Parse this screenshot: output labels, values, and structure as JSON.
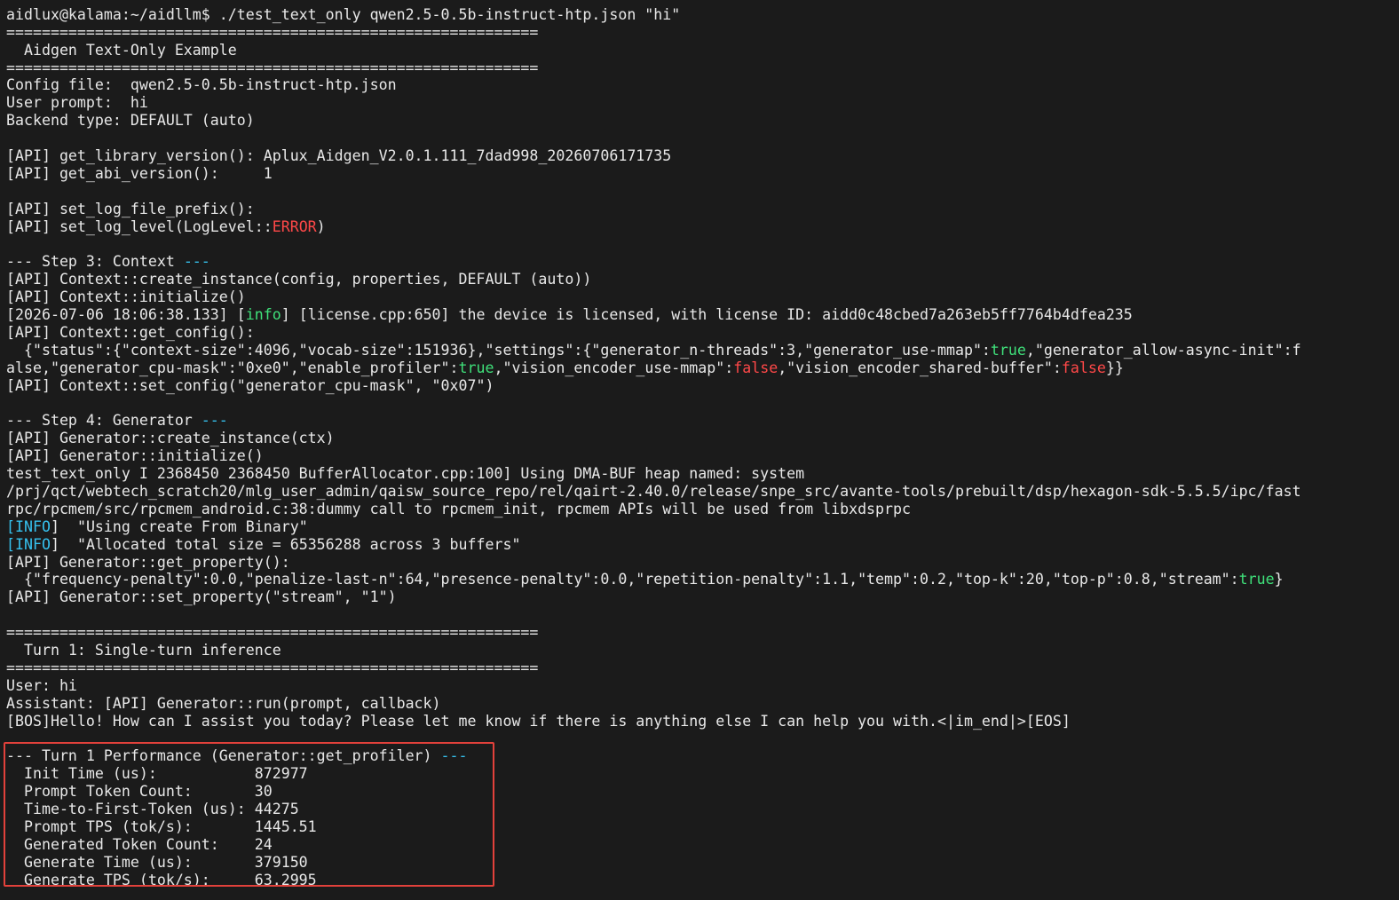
{
  "colors": {
    "background": "#1b1b1b",
    "text": "#e8e8e8",
    "error": "#ff4848",
    "true_value": "#3fe07a",
    "false_value": "#ff4848",
    "info": "#36c1ee",
    "highlight_box": "#e2413b"
  },
  "prompt_line": "aidlux@kalama:~/aidllm$ ./test_text_only qwen2.5-0.5b-instruct-htp.json \"hi\"",
  "sep": "============================================================",
  "header_title": "  Aidgen Text-Only Example",
  "config": {
    "config_file": "Config file:  qwen2.5-0.5b-instruct-htp.json",
    "user_prompt": "User prompt:  hi",
    "backend": "Backend type: DEFAULT (auto)"
  },
  "api": {
    "lib_version": "[API] get_library_version(): Aplux_Aidgen_V2.0.1.111_7dad998_20260706171735",
    "abi_version": "[API] get_abi_version():     1",
    "log_prefix": "[API] set_log_file_prefix():",
    "log_level_pre": "[API] set_log_level(LogLevel::",
    "log_level_val": "ERROR",
    "log_level_post": ")"
  },
  "step3": {
    "title": "--- Step 3: Context ",
    "dashes": "---",
    "create": "[API] Context::create_instance(config, properties, DEFAULT (auto))",
    "initialize": "[API] Context::initialize()",
    "license_pre": "[2026-07-06 18:06:38.133] [",
    "license_tag": "info",
    "license_post": "] [license.cpp:650] the device is licensed, with license ID: aidd0c48cbed7a263eb5ff7764b4dfea235",
    "get_config": "[API] Context::get_config():",
    "cfg1_a": "  {\"status\":{\"context-size\":4096,\"vocab-size\":151936},\"settings\":{\"generator_n-threads\":3,\"generator_use-mmap\":",
    "cfg1_true": "true",
    "cfg1_b": ",\"generator_allow-async-init\":f",
    "cfg2_a": "alse,\"generator_cpu-mask\":\"0xe0\",\"enable_profiler\":",
    "cfg2_true": "true",
    "cfg2_b": ",\"vision_encoder_use-mmap\":",
    "cfg2_false1": "false",
    "cfg2_c": ",\"vision_encoder_shared-buffer\":",
    "cfg2_false2": "false",
    "cfg2_d": "}}",
    "set_config": "[API] Context::set_config(\"generator_cpu-mask\", \"0x07\")"
  },
  "step4": {
    "title": "--- Step 4: Generator ",
    "dashes": "---",
    "create": "[API] Generator::create_instance(ctx)",
    "initialize": "[API] Generator::initialize()",
    "buffer": "test_text_only I 2368450 2368450 BufferAllocator.cpp:100] Using DMA-BUF heap named: system",
    "path1": "/prj/qct/webtech_scratch20/mlg_user_admin/qaisw_source_repo/rel/qairt-2.40.0/release/snpe_src/avante-tools/prebuilt/dsp/hexagon-sdk-5.5.5/ipc/fast",
    "path2": "rpc/rpcmem/src/rpcmem_android.c:38:dummy call to rpcmem_init, rpcmem APIs will be used from libxdsprpc",
    "info_open": "[",
    "info_tag": "INFO",
    "info_close": "]",
    "info1_text": "  \"Using create From Binary\"",
    "info2_text": "  \"Allocated total size = 65356288 across 3 buffers\"",
    "get_prop": "[API] Generator::get_property():",
    "prop_a": "  {\"frequency-penalty\":0.0,\"penalize-last-n\":64,\"presence-penalty\":0.0,\"repetition-penalty\":1.1,\"temp\":0.2,\"top-k\":20,\"top-p\":0.8,\"stream\":",
    "prop_true": "true",
    "prop_b": "}",
    "set_prop": "[API] Generator::set_property(\"stream\", \"1\")"
  },
  "turn1": {
    "title": "  Turn 1: Single-turn inference",
    "user": "User: hi",
    "assistant": "Assistant: [API] Generator::run(prompt, callback)",
    "response": "[BOS]Hello! How can I assist you today? Please let me know if there is anything else I can help you with.<|im_end|>[EOS]"
  },
  "performance": {
    "title": "--- Turn 1 Performance (Generator::get_profiler) ",
    "dashes": "---",
    "rows": [
      "  Init Time (us):           872977",
      "  Prompt Token Count:       30",
      "  Time-to-First-Token (us): 44275",
      "  Prompt TPS (tok/s):       1445.51",
      "  Generated Token Count:    24",
      "  Generate Time (us):       379150",
      "  Generate TPS (tok/s):     63.2995"
    ]
  }
}
